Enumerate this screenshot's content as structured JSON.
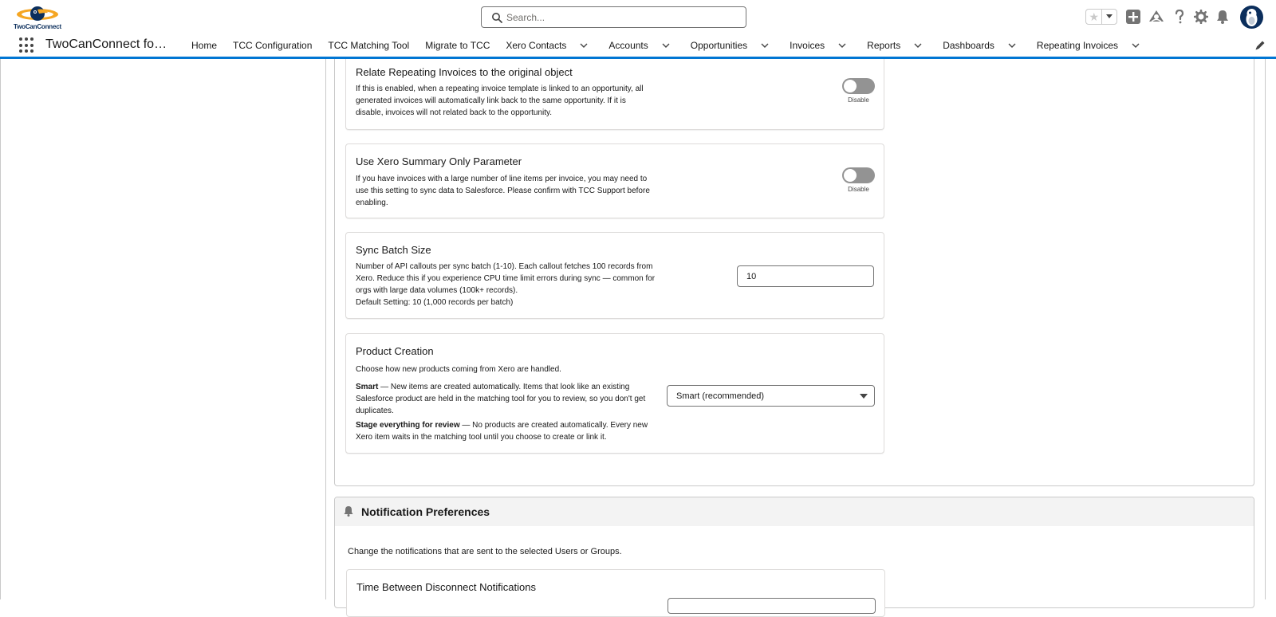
{
  "header": {
    "logo_text": "TwoCanConnect",
    "search_placeholder": "Search..."
  },
  "nav": {
    "app_name": "TwoCanConnect fo…",
    "items": [
      {
        "label": "Home",
        "has_menu": false
      },
      {
        "label": "TCC Configuration",
        "has_menu": false
      },
      {
        "label": "TCC Matching Tool",
        "has_menu": false
      },
      {
        "label": "Migrate to TCC",
        "has_menu": false
      },
      {
        "label": "Xero Contacts",
        "has_menu": true
      },
      {
        "label": "Accounts",
        "has_menu": true
      },
      {
        "label": "Opportunities",
        "has_menu": true
      },
      {
        "label": "Invoices",
        "has_menu": true
      },
      {
        "label": "Reports",
        "has_menu": true
      },
      {
        "label": "Dashboards",
        "has_menu": true
      },
      {
        "label": "Repeating Invoices",
        "has_menu": true
      }
    ]
  },
  "settings": {
    "relate_repeating": {
      "title": "Relate Repeating Invoices to the original object",
      "description": "If this is enabled, when a repeating invoice template is linked to an opportunity, all generated invoices will automatically link back to the same opportunity. If it is disable, invoices will not related back to the opportunity.",
      "toggle_label": "Disable"
    },
    "summary_only": {
      "title": "Use Xero Summary Only Parameter",
      "description": "If you have invoices with a large number of line items per invoice, you may need to use this setting to sync data to Salesforce. Please confirm with TCC Support before enabling.",
      "toggle_label": "Disable"
    },
    "batch_size": {
      "title": "Sync Batch Size",
      "description": "Number of API callouts per sync batch (1-10). Each callout fetches 100 records from Xero. Reduce this if you experience CPU time limit errors during sync — common for orgs with large data volumes (100k+ records).",
      "default_note": "Default Setting: 10 (1,000 records per batch)",
      "value": "10"
    },
    "product_creation": {
      "title": "Product Creation",
      "description": "Choose how new products coming from Xero are handled.",
      "smart_label": "Smart",
      "smart_text": " — New items are created automatically. Items that look like an existing Salesforce product are held in the matching tool for you to review, so you don't get duplicates.",
      "stage_label": "Stage everything for review",
      "stage_text": " — No products are created automatically. Every new Xero item waits in the matching tool until you choose to create or link it.",
      "selected": "Smart (recommended)"
    }
  },
  "notifications": {
    "title": "Notification Preferences",
    "description": "Change the notifications that are sent to the selected Users or Groups.",
    "disconnect_title": "Time Between Disconnect Notifications"
  }
}
